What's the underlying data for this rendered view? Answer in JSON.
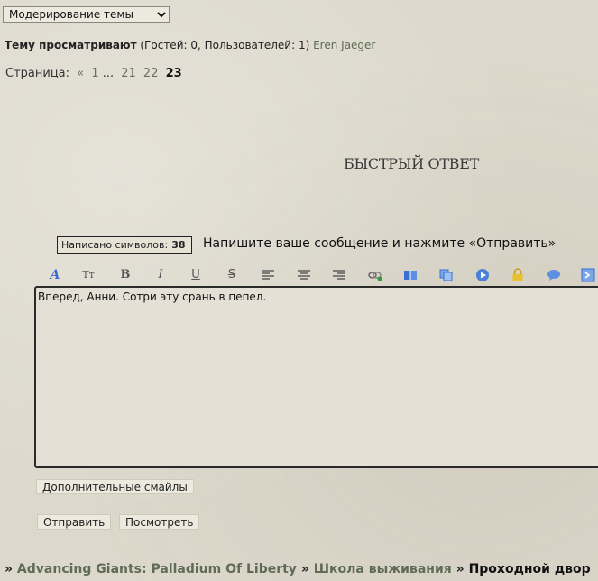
{
  "moderation": {
    "selected": "Модерирование темы"
  },
  "viewers": {
    "label": "Тему просматривают",
    "counts": "(Гостей: 0, Пользователей: 1)",
    "user": "Eren Jaeger"
  },
  "pager": {
    "label": "Страница:",
    "prev": "«",
    "first": "1",
    "ellipsis": "...",
    "p21": "21",
    "p22": "22",
    "current": "23"
  },
  "reply": {
    "title": "БЫСТРЫЙ ОТВЕТ",
    "counter_label": "Написано символов:",
    "counter_value": "38",
    "hint": "Напишите ваше сообщение и нажмите «Отправить»",
    "message": "Вперед, Анни. Сотри эту срань в пепел."
  },
  "toolbar": {
    "font": "A",
    "size": "Tт",
    "bold": "B",
    "italic": "I",
    "underline": "U",
    "strike": "S"
  },
  "buttons": {
    "smileys": "Дополнительные смайлы",
    "send": "Отправить",
    "preview": "Посмотреть"
  },
  "breadcrumbs": {
    "sep": "»",
    "forum": "Advancing Giants: Palladium Of Liberty",
    "section": "Школа выживания",
    "topic": "Проходной двор"
  }
}
